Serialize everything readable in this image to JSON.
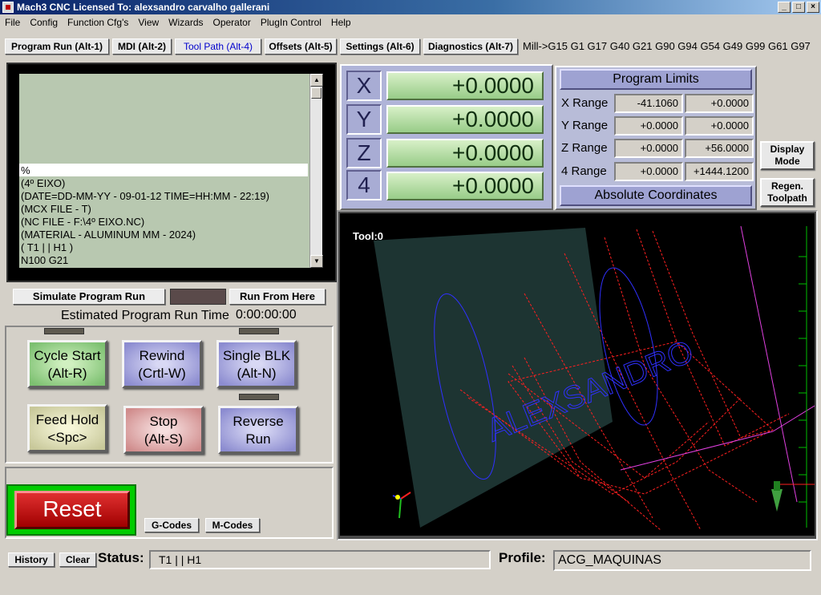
{
  "window": {
    "title": "Mach3 CNC  Licensed To: alexsandro carvalho gallerani"
  },
  "menu": [
    "File",
    "Config",
    "Function Cfg's",
    "View",
    "Wizards",
    "Operator",
    "PlugIn Control",
    "Help"
  ],
  "tabs": [
    {
      "label": "Program Run (Alt-1)"
    },
    {
      "label": "MDI (Alt-2)"
    },
    {
      "label": "Tool Path (Alt-4)",
      "active": true
    },
    {
      "label": "Offsets (Alt-5)"
    },
    {
      "label": "Settings (Alt-6)"
    },
    {
      "label": "Diagnostics (Alt-7)"
    }
  ],
  "modal_state": "Mill->G15  G1 G17 G40 G21 G90 G94 G54 G49 G99 G61 G97",
  "gcode": {
    "current_line": "%",
    "lines": [
      "(4º EIXO)",
      "(DATE=DD-MM-YY - 09-01-12 TIME=HH:MM - 22:19)",
      "(MCX FILE - T)",
      "(NC FILE - F:\\4º EIXO.NC)",
      "(MATERIAL - ALUMINUM MM - 2024)",
      "( T1 | | H1 )",
      "N100 G21"
    ]
  },
  "run_controls": {
    "simulate_label": "Simulate Program Run",
    "run_from_here_label": "Run From Here",
    "estimated_label": "Estimated Program Run Time",
    "estimated_value": "0:00:00:00"
  },
  "cycle_buttons": {
    "cycle_start": [
      "Cycle Start",
      "(Alt-R)"
    ],
    "rewind": [
      "Rewind",
      "(Crtl-W)"
    ],
    "single_blk": [
      "Single BLK",
      "(Alt-N)"
    ],
    "feed_hold": [
      "Feed Hold",
      "<Spc>"
    ],
    "stop": [
      "Stop",
      "(Alt-S)"
    ],
    "reverse_run": [
      "Reverse",
      "Run"
    ]
  },
  "reset_label": "Reset",
  "gcodes_label": "G-Codes",
  "mcodes_label": "M-Codes",
  "dro": [
    {
      "axis": "X",
      "value": "+0.0000"
    },
    {
      "axis": "Y",
      "value": "+0.0000"
    },
    {
      "axis": "Z",
      "value": "+0.0000"
    },
    {
      "axis": "4",
      "value": "+0.0000"
    }
  ],
  "program_limits": {
    "title": "Program Limits",
    "rows": [
      {
        "label": "X Range",
        "min": "-41.1060",
        "max": "+0.0000"
      },
      {
        "label": "Y Range",
        "min": "+0.0000",
        "max": "+0.0000"
      },
      {
        "label": "Z Range",
        "min": "+0.0000",
        "max": "+56.0000"
      },
      {
        "label": "4 Range",
        "min": "+0.0000",
        "max": "+1444.1200"
      }
    ],
    "coords_label": "Absolute Coordinates"
  },
  "side_buttons": {
    "display_mode": [
      "Display",
      "Mode"
    ],
    "regen": [
      "Regen.",
      "Toolpath"
    ]
  },
  "toolpath": {
    "tool_label": "Tool:0",
    "engraved_text": "ALEXSANDRO"
  },
  "colors": {
    "path_rapid": "#ff2020",
    "path_feed": "#3030ff",
    "stock_face": "#1d3432",
    "background": "#000000",
    "axis_line": "#e040e0",
    "ruler": "#00c000"
  },
  "bottom": {
    "history_label": "History",
    "clear_label": "Clear",
    "status_label": "Status:",
    "status_value": "T1 | | H1",
    "profile_label": "Profile:",
    "profile_value": "ACG_MAQUINAS"
  }
}
